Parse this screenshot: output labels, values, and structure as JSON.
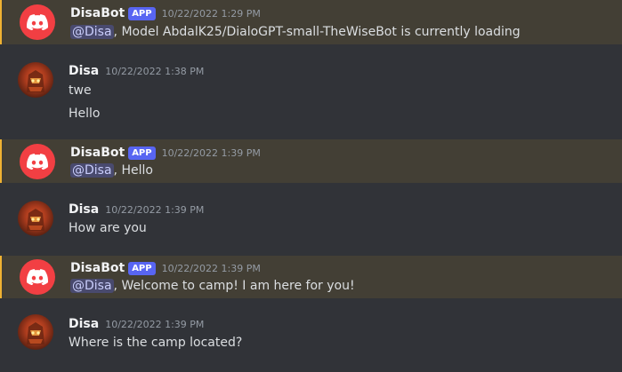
{
  "messages": [
    {
      "author": "DisaBot",
      "tag": "APP",
      "time": "10/22/2022 1:29 PM",
      "mention": "@Disa",
      "text": ", Model AbdalK25/DialoGPT-small-TheWiseBot is currently loading"
    },
    {
      "author": "Disa",
      "time": "10/22/2022 1:38 PM",
      "lines": [
        "twe",
        "Hello"
      ]
    },
    {
      "author": "DisaBot",
      "tag": "APP",
      "time": "10/22/2022 1:39 PM",
      "mention": "@Disa",
      "text": ",  Hello"
    },
    {
      "author": "Disa",
      "time": "10/22/2022 1:39 PM",
      "lines": [
        "How are you"
      ]
    },
    {
      "author": "DisaBot",
      "tag": "APP",
      "time": "10/22/2022 1:39 PM",
      "mention": "@Disa",
      "text": ",  Welcome to camp! I am here for you!"
    },
    {
      "author": "Disa",
      "time": "10/22/2022 1:39 PM",
      "lines": [
        "Where is the camp located?"
      ]
    }
  ],
  "icons": {
    "bot_avatar": "discord-logo-icon",
    "user_avatar": "user-avatar"
  },
  "colors": {
    "background": "#313338",
    "mention_highlight": "#433f35",
    "mention_border": "#f0b232",
    "bot_avatar": "#f23f43",
    "app_tag": "#5865f2"
  }
}
